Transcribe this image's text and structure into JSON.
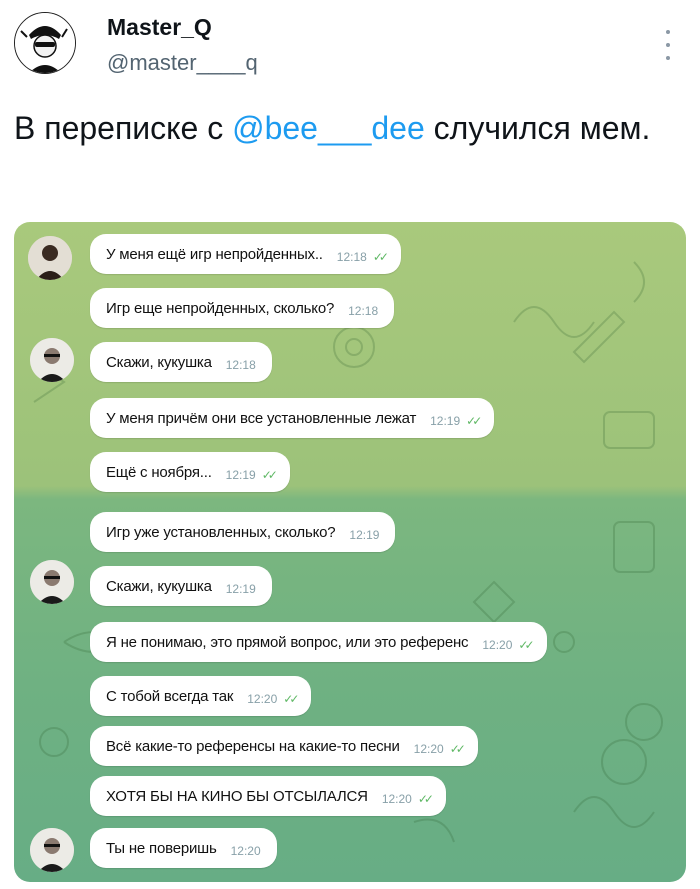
{
  "post": {
    "author_name": "Master_Q",
    "author_handle": "@master____q",
    "text_before": "В переписке с ",
    "mention": "@bee___dee",
    "text_after": " случился мем."
  },
  "messages": [
    {
      "text": "У меня ещё игр непройденных..",
      "time": "12:18",
      "ticks": "✓✓"
    },
    {
      "text": "Игр еще непройденных, сколько?",
      "time": "12:18",
      "ticks": ""
    },
    {
      "text": "Скажи, кукушка",
      "time": "12:18",
      "ticks": ""
    },
    {
      "text": "У меня причём они все установленные лежат",
      "time": "12:19",
      "ticks": "✓✓"
    },
    {
      "text": "Ещё с ноября...",
      "time": "12:19",
      "ticks": "✓✓"
    },
    {
      "text": "Игр уже установленных, сколько?",
      "time": "12:19",
      "ticks": ""
    },
    {
      "text": "Скажи, кукушка",
      "time": "12:19",
      "ticks": ""
    },
    {
      "text": "Я не понимаю, это прямой вопрос, или это референс",
      "time": "12:20",
      "ticks": "✓✓"
    },
    {
      "text": "С тобой всегда так",
      "time": "12:20",
      "ticks": "✓✓"
    },
    {
      "text": "Всё какие-то референсы на какие-то песни",
      "time": "12:20",
      "ticks": "✓✓"
    },
    {
      "text": "ХОТЯ БЫ НА КИНО БЫ ОТСЫЛАЛСЯ",
      "time": "12:20",
      "ticks": "✓✓"
    },
    {
      "text": "Ты не поверишь",
      "time": "12:20",
      "ticks": ""
    }
  ],
  "colors": {
    "mention": "#1d9bf0",
    "chat_bg_top": "#a9c97c",
    "chat_bg_bottom": "#67ad85",
    "read_ticks": "#5fb865"
  }
}
